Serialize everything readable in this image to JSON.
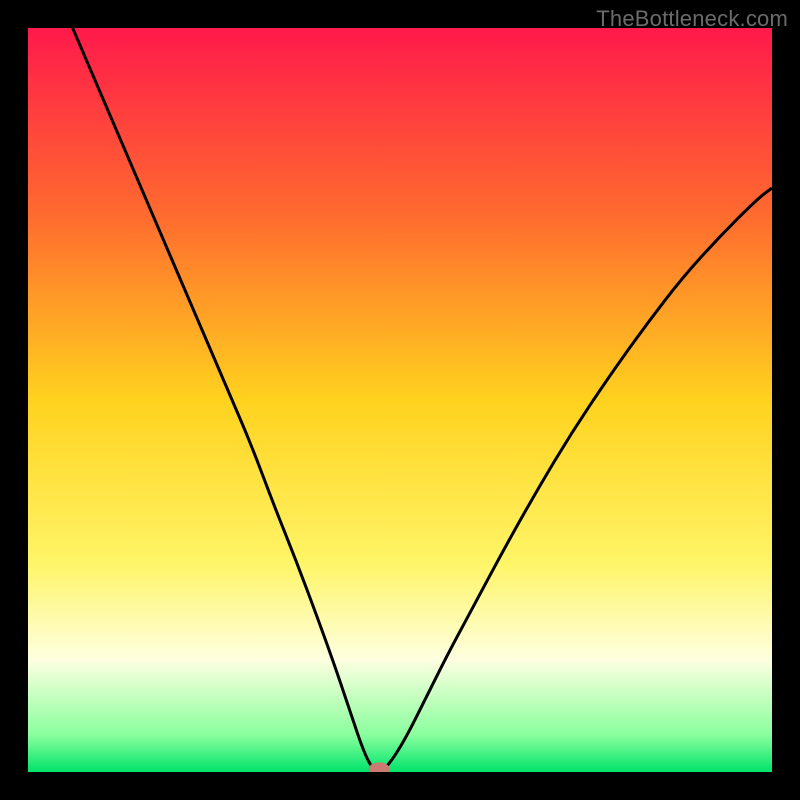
{
  "watermark": "TheBottleneck.com",
  "chart_data": {
    "type": "line",
    "title": "",
    "xlabel": "",
    "ylabel": "",
    "xlim": [
      0,
      1
    ],
    "ylim": [
      0,
      1
    ],
    "background_gradient": {
      "stops": [
        {
          "offset": 0.0,
          "color": "#ff1a4b"
        },
        {
          "offset": 0.25,
          "color": "#ff6a2f"
        },
        {
          "offset": 0.5,
          "color": "#ffd21e"
        },
        {
          "offset": 0.72,
          "color": "#fff568"
        },
        {
          "offset": 0.85,
          "color": "#fdffe0"
        },
        {
          "offset": 0.95,
          "color": "#8aff9e"
        },
        {
          "offset": 1.0,
          "color": "#00e36a"
        }
      ]
    },
    "series": [
      {
        "name": "bottleneck-curve",
        "color": "#000000",
        "width": 3,
        "points": [
          {
            "x": 0.06,
            "y": 1.0
          },
          {
            "x": 0.09,
            "y": 0.93
          },
          {
            "x": 0.12,
            "y": 0.86
          },
          {
            "x": 0.15,
            "y": 0.79
          },
          {
            "x": 0.18,
            "y": 0.72
          },
          {
            "x": 0.21,
            "y": 0.65
          },
          {
            "x": 0.24,
            "y": 0.58
          },
          {
            "x": 0.27,
            "y": 0.51
          },
          {
            "x": 0.3,
            "y": 0.44
          },
          {
            "x": 0.33,
            "y": 0.36
          },
          {
            "x": 0.36,
            "y": 0.285
          },
          {
            "x": 0.39,
            "y": 0.205
          },
          {
            "x": 0.415,
            "y": 0.135
          },
          {
            "x": 0.435,
            "y": 0.075
          },
          {
            "x": 0.451,
            "y": 0.028
          },
          {
            "x": 0.462,
            "y": 0.006
          },
          {
            "x": 0.47,
            "y": 0.0
          },
          {
            "x": 0.48,
            "y": 0.005
          },
          {
            "x": 0.492,
            "y": 0.02
          },
          {
            "x": 0.51,
            "y": 0.05
          },
          {
            "x": 0.535,
            "y": 0.1
          },
          {
            "x": 0.565,
            "y": 0.16
          },
          {
            "x": 0.6,
            "y": 0.225
          },
          {
            "x": 0.64,
            "y": 0.3
          },
          {
            "x": 0.685,
            "y": 0.38
          },
          {
            "x": 0.73,
            "y": 0.455
          },
          {
            "x": 0.78,
            "y": 0.53
          },
          {
            "x": 0.83,
            "y": 0.6
          },
          {
            "x": 0.88,
            "y": 0.665
          },
          {
            "x": 0.93,
            "y": 0.72
          },
          {
            "x": 0.98,
            "y": 0.77
          },
          {
            "x": 1.0,
            "y": 0.785
          }
        ]
      }
    ],
    "marker": {
      "x": 0.472,
      "y": 0.004,
      "rx": 0.014,
      "ry": 0.009,
      "color": "#cb7a72"
    },
    "frame": {
      "stroke": "#000000",
      "width": 28
    }
  }
}
